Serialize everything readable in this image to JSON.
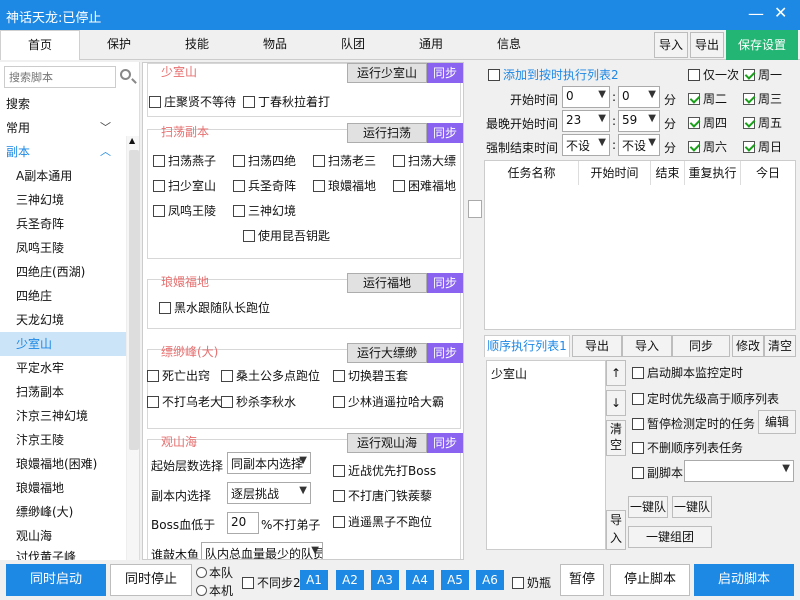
{
  "window": {
    "title": "神话天龙:已停止",
    "minimize": "—",
    "close": "✕"
  },
  "tabs": [
    "首页",
    "保护",
    "技能",
    "物品",
    "队团",
    "通用",
    "信息"
  ],
  "top_buttons": {
    "import": "导入",
    "export": "导出",
    "save": "保存设置"
  },
  "sidebar": {
    "search_placeholder": "搜索脚本",
    "items": [
      {
        "label": "搜索"
      },
      {
        "label": "常用"
      },
      {
        "label": "副本"
      },
      {
        "label": "A副本通用"
      },
      {
        "label": "三神幻境"
      },
      {
        "label": "兵圣奇阵"
      },
      {
        "label": "凤鸣王陵"
      },
      {
        "label": "四绝庄(西湖)"
      },
      {
        "label": "四绝庄"
      },
      {
        "label": "天龙幻境"
      },
      {
        "label": "少室山"
      },
      {
        "label": "平定水牢"
      },
      {
        "label": "扫荡副本"
      },
      {
        "label": "汴京三神幻境"
      },
      {
        "label": "汴京王陵"
      },
      {
        "label": "琅嬛福地(困难)"
      },
      {
        "label": "琅嬛福地"
      },
      {
        "label": "缥缈峰(大)"
      },
      {
        "label": "观山海"
      },
      {
        "label": "讨伐黄子峰"
      }
    ]
  },
  "shaoshishan": {
    "title": "少室山",
    "run": "运行少室山",
    "sync": "同步",
    "options": [
      "庄聚贤不等待",
      "丁春秋拉着打"
    ]
  },
  "saodang": {
    "title": "扫荡副本",
    "run": "运行扫荡",
    "sync": "同步",
    "options": [
      "扫荡燕子",
      "扫荡四绝",
      "扫荡老三",
      "扫荡大缥",
      "扫少室山",
      "兵圣奇阵",
      "琅嬛福地",
      "困难福地",
      "凤鸣王陵",
      "三神幻境",
      "使用昆吾钥匙"
    ]
  },
  "langhuan": {
    "title": "琅嬛福地",
    "run": "运行福地",
    "sync": "同步",
    "options": [
      "黑水跟随队长跑位"
    ]
  },
  "piaomiao": {
    "title": "缥缈峰(大)",
    "run": "运行大缥缈",
    "sync": "同步",
    "options": [
      "死亡出窍",
      "桑土公多点跑位",
      "切换碧玉套",
      "不打乌老大",
      "秒杀李秋水",
      "少林逍遥拉哈大霸"
    ]
  },
  "guanshanhai": {
    "title": "观山海",
    "run": "运行观山海",
    "sync": "同步",
    "start_floor_label": "起始层数选择",
    "start_floor_value": "同副本内选择",
    "inner_label": "副本内选择",
    "inner_value": "逐层挑战",
    "boss_label": "Boss血低于",
    "boss_value": "20",
    "boss_suffix": "%不打弟子",
    "wood_label": "谁敲木鱼",
    "wood_value": "队内总血量最少的队员",
    "options": [
      "近战优先打Boss",
      "不打唐门铁蒺藜",
      "逍遥黑子不跑位"
    ]
  },
  "schedule": {
    "add_label": "添加到按时执行列表2",
    "once": "仅一次",
    "start_time_label": "开始时间",
    "start_h": "0",
    "start_m": "0",
    "latest_label": "最晚开始时间",
    "latest_h": "23",
    "latest_m": "59",
    "force_label": "强制结束时间",
    "force_h": "不设",
    "force_m": "不设",
    "min_unit": "分",
    "weekdays": [
      {
        "label": "周一",
        "on": true
      },
      {
        "label": "周二",
        "on": true
      },
      {
        "label": "周三",
        "on": true
      },
      {
        "label": "周四",
        "on": true
      },
      {
        "label": "周五",
        "on": true
      },
      {
        "label": "周六",
        "on": true
      },
      {
        "label": "周日",
        "on": true
      }
    ]
  },
  "task_table": {
    "columns": [
      "任务名称",
      "开始时间",
      "结束",
      "重复执行",
      "今日"
    ]
  },
  "sequence": {
    "tab_label": "顺序执行列表1",
    "export": "导出",
    "import": "导入",
    "sync": "同步",
    "edit": "修改",
    "clear": "清空",
    "items": [
      "少室山"
    ],
    "up": "↑",
    "down": "↓",
    "clear_btn": "清空",
    "import_btn": "导入",
    "options": [
      "启动脚本监控定时",
      "定时优先级高于顺序列表",
      "暂停检测定时的任务",
      "不删顺序列表任务",
      "副脚本"
    ],
    "edit_btn": "编辑",
    "one_key_team": "一键队",
    "one_key_team2": "一键队",
    "one_key_group": "一键组团"
  },
  "bottom": {
    "start_all": "同时启动",
    "stop_all": "同时停止",
    "this_team": "本队",
    "this_machine": "本机",
    "no_sync": "不同步2",
    "a_buttons": [
      "A1",
      "A2",
      "A3",
      "A4",
      "A5",
      "A6"
    ],
    "milk": "奶瓶",
    "pause": "暂停",
    "stop_script": "停止脚本",
    "start_script": "启动脚本"
  },
  "colors": {
    "accent": "#1e88e5",
    "purple": "#8a64f0",
    "green": "#22b573",
    "section_title": "#e76f6f"
  }
}
